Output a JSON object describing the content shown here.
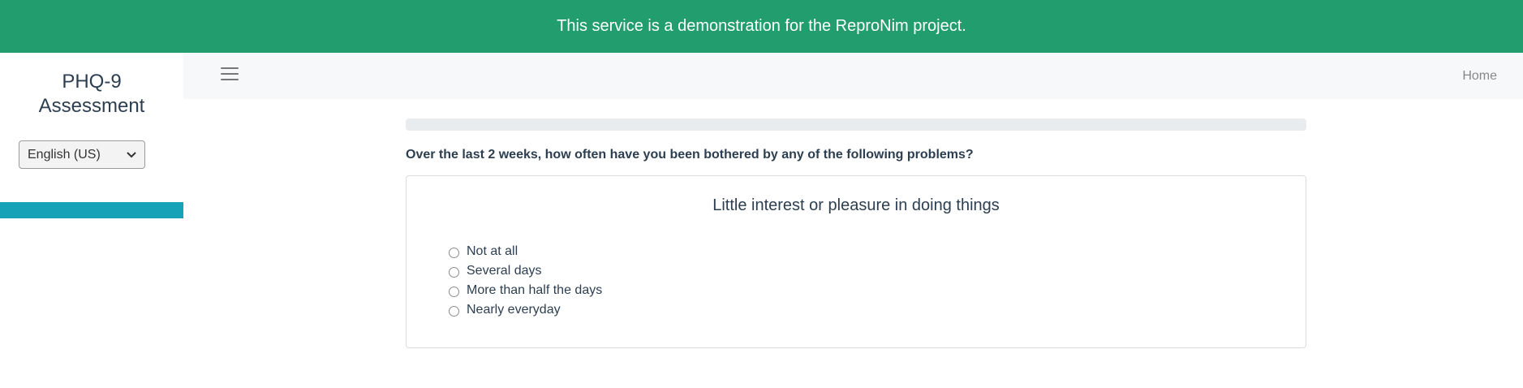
{
  "banner": {
    "text": "This service is a demonstration for the ReproNim project."
  },
  "sidebar": {
    "title": "PHQ-9 Assessment",
    "language": {
      "selected": "English (US)"
    },
    "progress_fraction": 1.0
  },
  "nav": {
    "home_label": "Home"
  },
  "survey": {
    "progress_fraction": 0.0,
    "preamble": "Over the last 2 weeks, how often have you been bothered by any of the following problems?",
    "question": "Little interest or pleasure in doing things",
    "options": [
      "Not at all",
      "Several days",
      "More than half the days",
      "Nearly everyday"
    ]
  },
  "colors": {
    "banner": "#229e6e",
    "accent": "#17a2b8",
    "text": "#2c3e50"
  },
  "icons": {
    "menu": "hamburger-icon",
    "select_arrow": "chevron-down-icon"
  }
}
